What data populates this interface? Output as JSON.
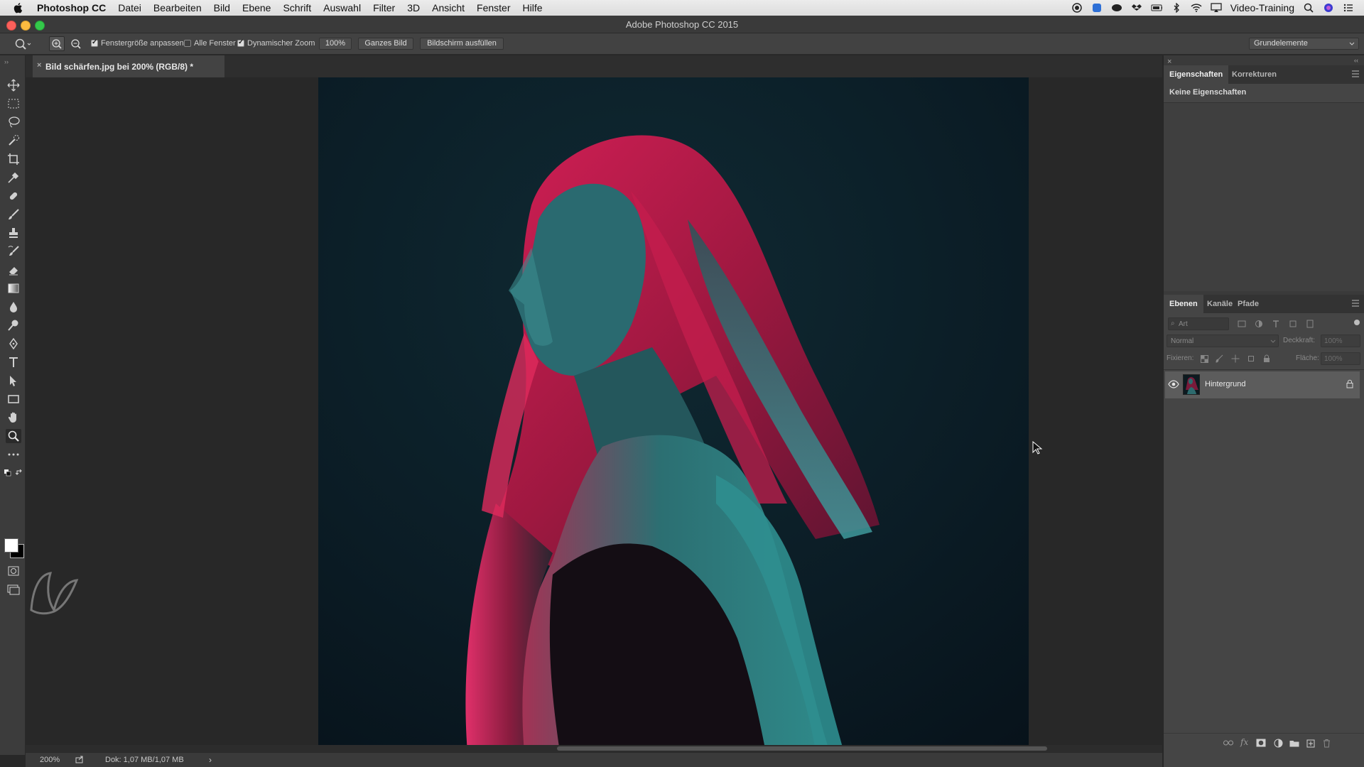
{
  "menubar": {
    "app_name": "Photoshop CC",
    "items": [
      "Datei",
      "Bearbeiten",
      "Bild",
      "Ebene",
      "Schrift",
      "Auswahl",
      "Filter",
      "3D",
      "Ansicht",
      "Fenster",
      "Hilfe"
    ],
    "right_user": "Video-Training"
  },
  "window": {
    "title": "Adobe Photoshop CC 2015"
  },
  "options": {
    "resize_windows_label": "Fenstergröße anpassen",
    "all_windows_label": "Alle Fenster",
    "scrubby_zoom_label": "Dynamischer Zoom",
    "zoom_100_label": "100%",
    "fit_screen_label": "Ganzes Bild",
    "fill_screen_label": "Bildschirm ausfüllen",
    "workspace_label": "Grundelemente"
  },
  "document": {
    "tab_title": "Bild schärfen.jpg bei 200% (RGB/8) *"
  },
  "statusbar": {
    "zoom": "200%",
    "doc_info": "Dok: 1,07 MB/1,07 MB"
  },
  "properties_panel": {
    "tabs": [
      "Eigenschaften",
      "Korrekturen"
    ],
    "empty_text": "Keine Eigenschaften"
  },
  "layers_panel": {
    "tabs": [
      "Ebenen",
      "Kanäle",
      "Pfade"
    ],
    "filter_placeholder": "Art",
    "blend_mode": "Normal",
    "opacity_label": "Deckkraft:",
    "opacity_value": "100%",
    "lock_label": "Fixieren:",
    "fill_label": "Fläche:",
    "fill_value": "100%",
    "layers": [
      {
        "name": "Hintergrund"
      }
    ]
  },
  "colors": {
    "accent_selected": "#5a5a5a",
    "panel_bg": "#3a3a3a"
  }
}
